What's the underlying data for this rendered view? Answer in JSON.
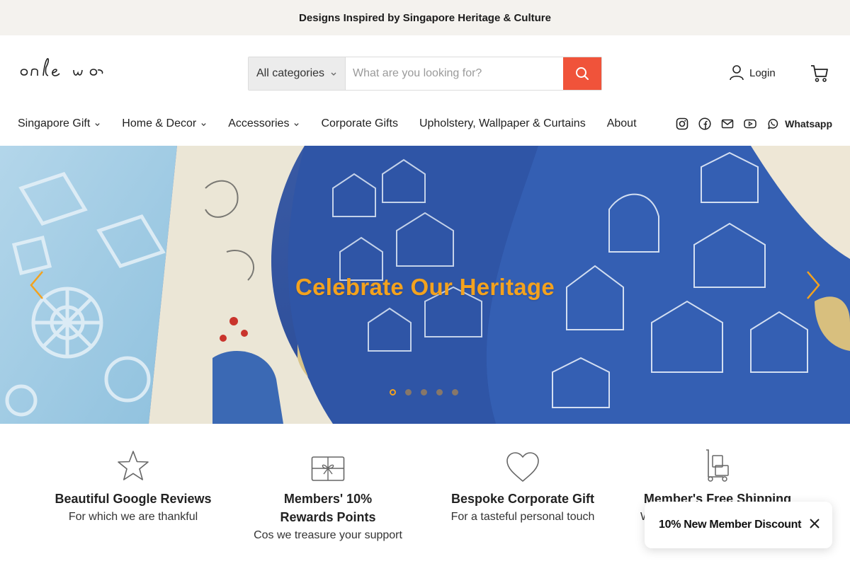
{
  "announcement": "Designs Inspired by Singapore Heritage & Culture",
  "brand": {
    "logo_text": "onlewo"
  },
  "search": {
    "category": "All categories",
    "placeholder": "What are you looking for?"
  },
  "account": {
    "login_label": "Login"
  },
  "nav": {
    "items": [
      {
        "label": "Singapore Gift",
        "dropdown": true
      },
      {
        "label": "Home & Decor",
        "dropdown": true
      },
      {
        "label": "Accessories",
        "dropdown": true
      },
      {
        "label": "Corporate Gifts",
        "dropdown": false
      },
      {
        "label": "Upholstery, Wallpaper & Curtains",
        "dropdown": false
      },
      {
        "label": "About",
        "dropdown": false
      }
    ],
    "social": [
      "instagram-icon",
      "facebook-icon",
      "mail-icon",
      "youtube-icon",
      "whatsapp-icon"
    ],
    "whatsapp_label": "Whatsapp"
  },
  "hero": {
    "headline": "Celebrate Our Heritage",
    "slide_count": 5,
    "active_slide": 1,
    "accent_color": "#f3a21e"
  },
  "features": [
    {
      "icon": "star-icon",
      "title": "Beautiful Google Reviews",
      "subtitle": "For which we are thankful"
    },
    {
      "icon": "gift-card-icon",
      "title": "Members' 10% Rewards Points",
      "subtitle": "Cos we treasure your support"
    },
    {
      "icon": "heart-icon",
      "title": "Bespoke Corporate Gift",
      "subtitle": "For a tasteful personal touch"
    },
    {
      "icon": "delivery-icon",
      "title": "Member's Free Shipping",
      "subtitle": "W"
    }
  ],
  "toast": {
    "text": "10% New Member Discount"
  },
  "colors": {
    "search_button": "#f0533a",
    "announcement_bg": "#f4f2ee",
    "headline": "#f3a21e"
  }
}
